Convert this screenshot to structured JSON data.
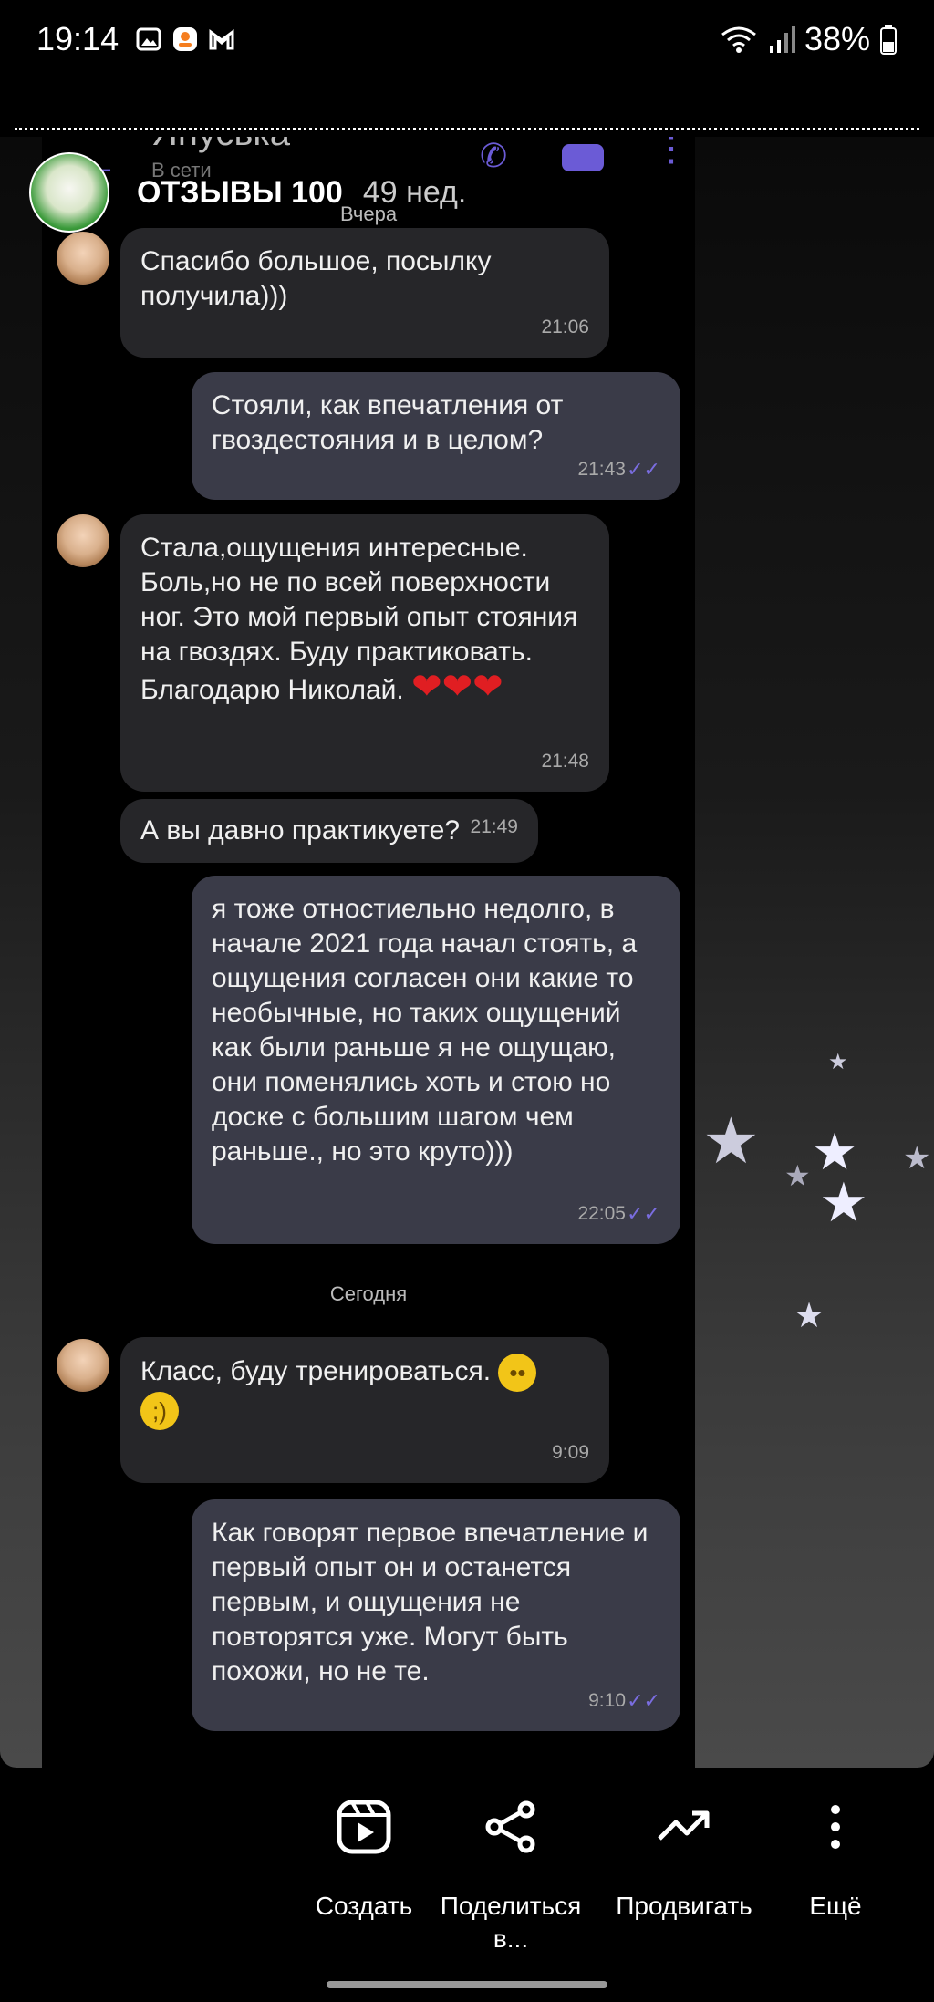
{
  "status_bar": {
    "time": "19:14",
    "battery": "38%",
    "icons": [
      "gallery-icon",
      "ok-app-icon",
      "gmail-icon",
      "wifi-icon",
      "signal-icon",
      "battery-icon"
    ]
  },
  "profile": {
    "name": "ОТЗЫВЫ 100",
    "posted_ago": "49 нед."
  },
  "chat": {
    "contact_name": "Януська",
    "contact_status": "В сети",
    "accent_color": "#6b5bd6",
    "days": [
      {
        "label": "Вчера",
        "messages": [
          {
            "dir": "in",
            "text": "Спасибо большое, посылку получила)))",
            "time": "21:06"
          },
          {
            "dir": "out",
            "text": "Стояли, как впечатления от гвоздестояния и в целом?",
            "time": "21:43"
          },
          {
            "dir": "in",
            "text": "Стала,ощущения  интересные. Боль,но  не по всей поверхности ног. Это мой первый опыт стояния на гвоздях. Буду практиковать. Благодарю Николай.",
            "time": "21:48"
          },
          {
            "dir": "in",
            "text": "А вы давно практикуете?",
            "time": "21:49"
          },
          {
            "dir": "out",
            "text": "я тоже отностиельно недолго, в начале 2021 года начал стоять, а ощущения согласен они какие то необычные, но таких ощущений как были раньше я не ощущаю, они поменялись хоть и стою но доске с большим шагом чем раньше., но это круто)))",
            "time": "22:05"
          }
        ]
      },
      {
        "label": "Сегодня",
        "messages": [
          {
            "dir": "in",
            "text": "Класс, буду тренироваться.",
            "time": "9:09"
          },
          {
            "dir": "out",
            "text": "Как говорят первое впечатление и первый опыт он и останется первым, и ощущения не повторятся уже. Могут быть похожи, но не те.",
            "time": "9:10"
          }
        ]
      }
    ]
  },
  "actions": [
    {
      "label": "Создать",
      "icon": "reels-create-icon"
    },
    {
      "label": "Поделиться в...",
      "icon": "share-icon"
    },
    {
      "label": "Продвигать",
      "icon": "trending-icon"
    },
    {
      "label": "Ещё",
      "icon": "more-vertical-icon"
    }
  ]
}
